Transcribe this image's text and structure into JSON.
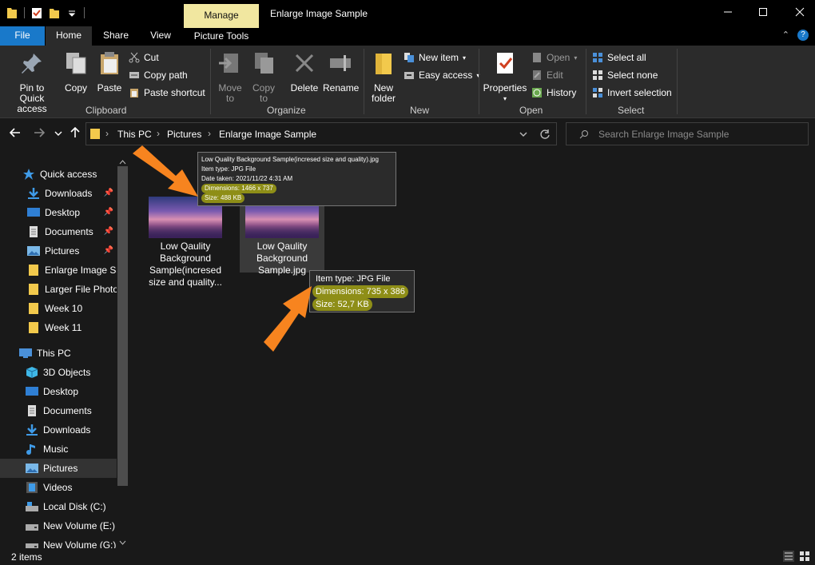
{
  "window": {
    "manage_tab": "Manage",
    "title": "Enlarge Image Sample"
  },
  "tabs": {
    "file": "File",
    "home": "Home",
    "share": "Share",
    "view": "View",
    "picture_tools": "Picture Tools"
  },
  "ribbon": {
    "clipboard": {
      "label": "Clipboard",
      "pin": "Pin to Quick access",
      "copy": "Copy",
      "paste": "Paste",
      "cut": "Cut",
      "copy_path": "Copy path",
      "paste_shortcut": "Paste shortcut"
    },
    "organize": {
      "label": "Organize",
      "move_to": "Move to",
      "copy_to": "Copy to",
      "delete": "Delete",
      "rename": "Rename"
    },
    "new": {
      "label": "New",
      "new_folder": "New folder",
      "new_item": "New item",
      "easy_access": "Easy access"
    },
    "open": {
      "label": "Open",
      "properties": "Properties",
      "open": "Open",
      "edit": "Edit",
      "history": "History"
    },
    "select": {
      "label": "Select",
      "select_all": "Select all",
      "select_none": "Select none",
      "invert": "Invert selection"
    }
  },
  "address": {
    "crumbs": [
      "This PC",
      "Pictures",
      "Enlarge Image Sample"
    ],
    "search_placeholder": "Search Enlarge Image Sample"
  },
  "sidebar": {
    "quick_access": "Quick access",
    "quick_items": [
      "Downloads",
      "Desktop",
      "Documents",
      "Pictures",
      "Enlarge Image Sa",
      "Larger File Photos",
      "Week 10",
      "Week 11"
    ],
    "this_pc": "This PC",
    "pc_items": [
      "3D Objects",
      "Desktop",
      "Documents",
      "Downloads",
      "Music",
      "Pictures",
      "Videos",
      "Local Disk (C:)",
      "New Volume (E:)",
      "New Volume (G:)"
    ]
  },
  "files": [
    {
      "name_lines": [
        "Low Qaulity",
        "Background",
        "Sample(incresed",
        "size and quality..."
      ]
    },
    {
      "name_lines": [
        "Low Qaulity",
        "Background",
        "Sample.jpg"
      ]
    }
  ],
  "tooltip_large": {
    "name": "Low Quality Background Sample(incresed size and quality).jpg",
    "type": "Item type: JPG File",
    "date": "Date taken: 2021/11/22 4:31 AM",
    "dimensions": "Dimensions: 1466 x 737",
    "size": "Size: 488 KB"
  },
  "tooltip_small": {
    "type": "Item type: JPG File",
    "dimensions": "Dimensions: 735 x 386",
    "size": "Size: 52,7 KB"
  },
  "status": {
    "items": "2 items"
  },
  "colors": {
    "accent": "#1979ca",
    "manage": "#f1e7a0",
    "highlight": "#8e8e17",
    "arrow": "#f7841f"
  }
}
